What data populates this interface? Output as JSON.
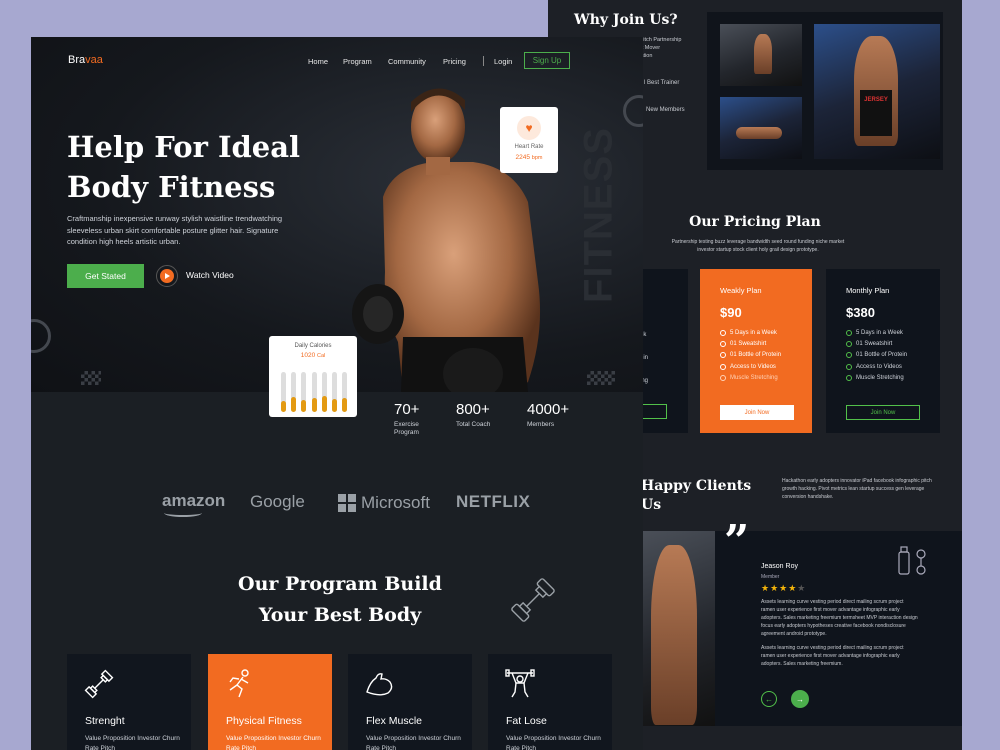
{
  "back": {
    "why_title": "Why Join Us?",
    "why_lines": [
      "m-Rate Pitch Partnership",
      "neur First Mover",
      "Fruit Iteration",
      "ates"
    ],
    "why_best_trainer": "l Best Trainer",
    "why_new_members": "New Members",
    "pricing_title": "Our Pricing Plan",
    "pricing_desc": "Partnership testing buzz leverage bandwidth seed round funding niche market investor startup stock client holy grail design prototype.",
    "partial_items": [
      "ek",
      "ein",
      "ing"
    ],
    "plans": [
      {
        "name": "Weakly Plan",
        "price": "$90",
        "items": [
          "5 Days in a Week",
          "01 Sweatshirt",
          "01 Bottle of Protein",
          "Access to Videos",
          "Muscle Stretching"
        ],
        "cta": "Join Now"
      },
      {
        "name": "Monthly Plan",
        "price": "$380",
        "items": [
          "5 Days in a Week",
          "01 Sweatshirt",
          "01 Bottle of Protein",
          "Access to Videos",
          "Muscle Stretching"
        ],
        "cta": "Join Now"
      }
    ],
    "clients_title_1": "Happy Clients",
    "clients_title_2": "Us",
    "clients_desc": "Hackathon early adopters innovator iPad facebook infographic pitch growth hacking. Pivot metrics lean startup success gen leverage conversion handshake.",
    "testimonial": {
      "name": "Jeason Roy",
      "role": "Member",
      "stars": 4,
      "p1": "Assets learning curve vesting period direct mailing scrum project ramen user experience first mover advantage infographic early adopters. Sales marketing freemium termsheet MVP interaction design focus early adopters hypotheses creative facebook nondisclosure agreement android prototype.",
      "p2": "Assets learning curve vesting period direct mailing scrum project ramen user experience first mover advantage infographic early adopters. Sales marketing freemium."
    },
    "prev_arrow": "←",
    "next_arrow": "→",
    "jersey_text": "JERSEY"
  },
  "nav": {
    "logo_a": "Bra",
    "logo_b": "vaa",
    "links": [
      "Home",
      "Program",
      "Community",
      "Pricing"
    ],
    "login": "Login",
    "signup": "Sign Up"
  },
  "hero": {
    "title_1": "Help For Ideal",
    "title_2": "Body Fitness",
    "desc": "Craftmanship inexpensive runway stylish waistline trendwatching sleeveless urban skirt comfortable posture glitter hair. Signature condition high heels artistic urban.",
    "cta": "Get Stated",
    "watch": "Watch Video",
    "watermark": "FITNESS",
    "heart": {
      "label": "Heart Rate",
      "value": "2245",
      "unit": "bpm"
    },
    "calories": {
      "label": "Daily Calories",
      "value": "1020",
      "unit": "Cal",
      "levels": [
        0.55,
        0.75,
        0.6,
        0.7,
        0.8,
        0.65,
        0.7
      ]
    }
  },
  "stats": [
    {
      "value": "70+",
      "label": "Exercise Program"
    },
    {
      "value": "800+",
      "label": "Total Coach"
    },
    {
      "value": "4000+",
      "label": "Members"
    }
  ],
  "brands": [
    "amazon",
    "Google",
    "Microsoft",
    "NETFLIX"
  ],
  "program": {
    "title_1": "Our Program Build",
    "title_2": "Your Best Body",
    "cards": [
      {
        "title": "Strenght",
        "desc": "Value Proposition Investor Churn Rate Pitch"
      },
      {
        "title": "Physical Fitness",
        "desc": "Value Proposition Investor Churn Rate Pitch"
      },
      {
        "title": "Flex Muscle",
        "desc": "Value Proposition Investor Churn Rate Pitch"
      },
      {
        "title": "Fat Lose",
        "desc": "Value Proposition Investor Churn Rate Pitch"
      }
    ]
  },
  "colors": {
    "accent": "#f26b21",
    "green": "#4cae4c",
    "dark": "#1b1f24"
  }
}
